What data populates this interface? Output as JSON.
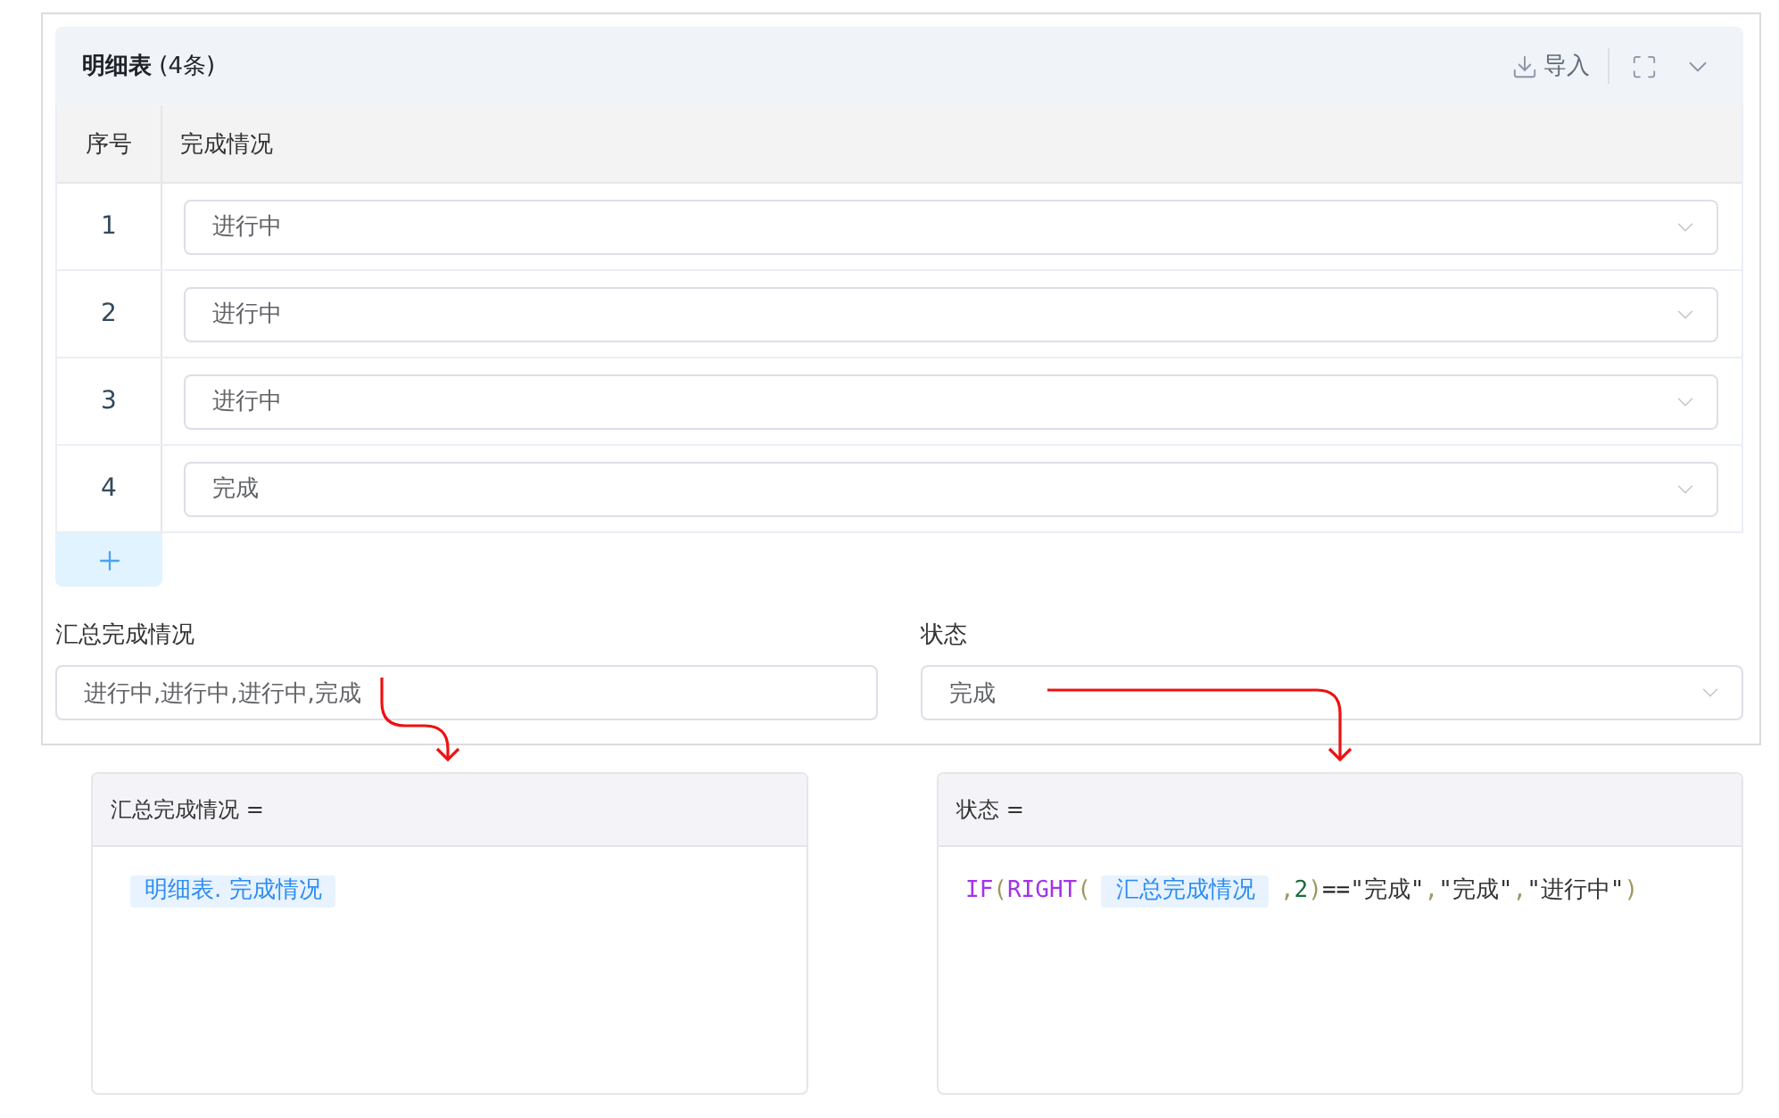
{
  "detail_table": {
    "title": "**明细表** (4条)",
    "import_label": "导入",
    "columns": [
      "序号",
      "完成情况"
    ],
    "rows": [
      {
        "index": "1",
        "status": "进行中"
      },
      {
        "index": "2",
        "status": "进行中"
      },
      {
        "index": "3",
        "status": "进行中"
      },
      {
        "index": "4",
        "status": "完成"
      }
    ]
  },
  "fields": [
    {
      "kind": "input",
      "label": "汇总完成情况",
      "value": "进行中,进行中,进行中,完成"
    },
    {
      "kind": "select",
      "label": "状态",
      "value": "完成"
    }
  ],
  "formulas": [
    {
      "title": "汇总完成情况 =",
      "parts": [
        {
          "kind": "field",
          "text": "明细表. 完成情况"
        }
      ]
    },
    {
      "title": "状态 =",
      "parts": [
        {
          "kind": "code",
          "tokens": [
            {
              "kind": "function",
              "text": "IF"
            },
            {
              "kind": "bracket",
              "text": "("
            },
            {
              "kind": "function",
              "text": "RIGHT"
            },
            {
              "kind": "bracket",
              "text": "("
            }
          ]
        },
        {
          "kind": "field",
          "text": "汇总完成情况"
        },
        {
          "kind": "code",
          "tokens": [
            {
              "kind": "bracket",
              "text": ","
            },
            {
              "kind": "number",
              "text": "2"
            },
            {
              "kind": "bracket",
              "text": ")"
            },
            {
              "kind": "operator",
              "text": "=="
            },
            {
              "kind": "string",
              "text": "\"完成\""
            },
            {
              "kind": "bracket",
              "text": ","
            },
            {
              "kind": "string",
              "text": "\"完成\""
            },
            {
              "kind": "bracket",
              "text": ","
            },
            {
              "kind": "string",
              "text": "\"进行中\""
            },
            {
              "kind": "bracket",
              "text": ")"
            }
          ]
        }
      ]
    }
  ]
}
